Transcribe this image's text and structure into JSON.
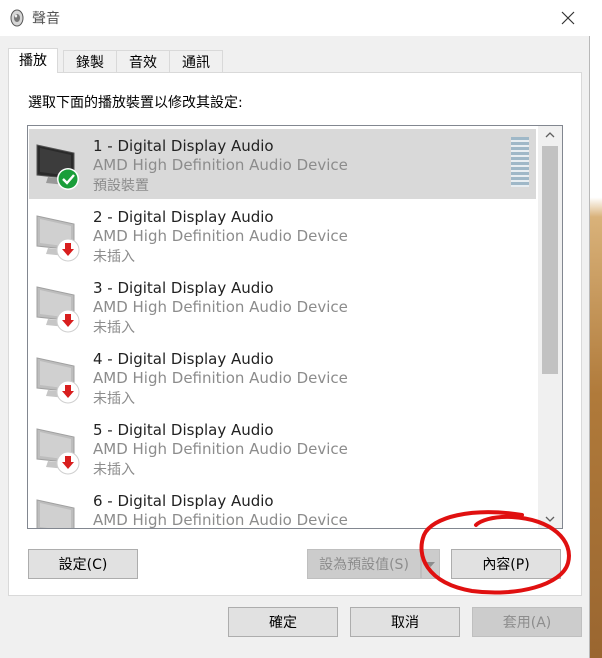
{
  "window": {
    "title": "聲音",
    "close_label": "✕"
  },
  "tabs": [
    {
      "label": "播放",
      "active": true
    },
    {
      "label": "錄製",
      "active": false
    },
    {
      "label": "音效",
      "active": false
    },
    {
      "label": "通訊",
      "active": false
    }
  ],
  "instruction": "選取下面的播放裝置以修改其設定:",
  "devices": [
    {
      "name": "1 - Digital Display Audio",
      "driver": "AMD High Definition Audio Device",
      "status": "預設裝置",
      "state": "default",
      "selected": true
    },
    {
      "name": "2 - Digital Display Audio",
      "driver": "AMD High Definition Audio Device",
      "status": "未插入",
      "state": "unplugged",
      "selected": false
    },
    {
      "name": "3 - Digital Display Audio",
      "driver": "AMD High Definition Audio Device",
      "status": "未插入",
      "state": "unplugged",
      "selected": false
    },
    {
      "name": "4 - Digital Display Audio",
      "driver": "AMD High Definition Audio Device",
      "status": "未插入",
      "state": "unplugged",
      "selected": false
    },
    {
      "name": "5 - Digital Display Audio",
      "driver": "AMD High Definition Audio Device",
      "status": "未插入",
      "state": "unplugged",
      "selected": false
    },
    {
      "name": "6 - Digital Display Audio",
      "driver": "AMD High Definition Audio Device",
      "status": "",
      "state": "unplugged",
      "selected": false
    }
  ],
  "buttons": {
    "configure": "設定(C)",
    "set_default": "設為預設值(S)",
    "properties": "內容(P)",
    "ok": "確定",
    "cancel": "取消",
    "apply": "套用(A)"
  },
  "colors": {
    "selected_row": "#d9d9d9",
    "default_badge": "#1a9e3a",
    "unplugged_badge": "#d81e1e",
    "annotation": "#e01010"
  },
  "icons": {
    "title": "speaker-icon",
    "device": "monitor-icon",
    "default_badge": "checkmark-icon",
    "unplugged_badge": "down-arrow-icon"
  }
}
